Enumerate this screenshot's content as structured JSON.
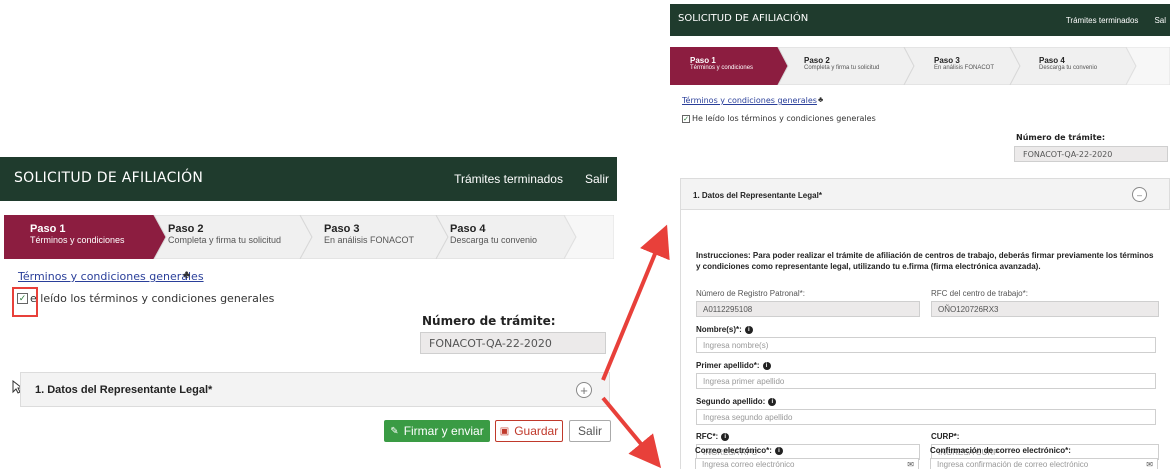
{
  "header": {
    "title": "SOLICITUD DE AFILIACIÓN",
    "link_tramites": "Trámites terminados",
    "link_salir": "Salir",
    "link_salir_truncated": "Sal"
  },
  "steps": [
    {
      "name": "Paso 1",
      "desc": "Términos y condiciones"
    },
    {
      "name": "Paso 2",
      "desc": "Completa y firma tu solicitud"
    },
    {
      "name": "Paso 3",
      "desc": "En análisis FONACOT"
    },
    {
      "name": "Paso 4",
      "desc": "Descarga tu convenio"
    }
  ],
  "terms_link": "Términos y condiciones generales",
  "checkbox_label": "He leído los términos y condiciones generales",
  "checkbox_label_cut": "e leído los términos y condiciones generales",
  "tramite": {
    "label": "Número de trámite:",
    "value": "FONACOT-QA-22-2020"
  },
  "section_title": "1. Datos del Representante Legal*",
  "buttons": {
    "firmar": "Firmar y enviar",
    "guardar": "Guardar",
    "salir": "Salir"
  },
  "form": {
    "instructions": "Instrucciones: Para poder realizar el trámite de afiliación de centros de trabajo, deberás firmar previamente los términos y condiciones como representante legal, utilizando tu e.firma (firma electrónica avanzada).",
    "registro_label": "Número de Registro Patronal*:",
    "registro_value": "A0112295108",
    "rfc_centro_label": "RFC del centro de trabajo*:",
    "rfc_centro_value": "OÑO120726RX3",
    "nombre_label": "Nombre(s)*:",
    "nombre_ph": "Ingresa nombre(s)",
    "ap1_label": "Primer apellido*:",
    "ap1_ph": "Ingresa primer apellido",
    "ap2_label": "Segundo apellido:",
    "ap2_ph": "Ingresa segundo apellido",
    "rfc_label": "RFC*:",
    "rfc_ph": "INGRESA RFC",
    "curp_label": "CURP*:",
    "curp_ph": "INGRESA CURP",
    "correo_label": "Correo electrónico*:",
    "correo_ph": "Ingresa correo electrónico",
    "conf_label": "Confirmación de correo electrónico*:",
    "conf_ph": "Ingresa confirmación de correo electrónico"
  },
  "colors": {
    "header": "#1f3b2d",
    "active_step": "#8c1d40",
    "green_btn": "#3a9b44",
    "red": "#e8403a"
  }
}
